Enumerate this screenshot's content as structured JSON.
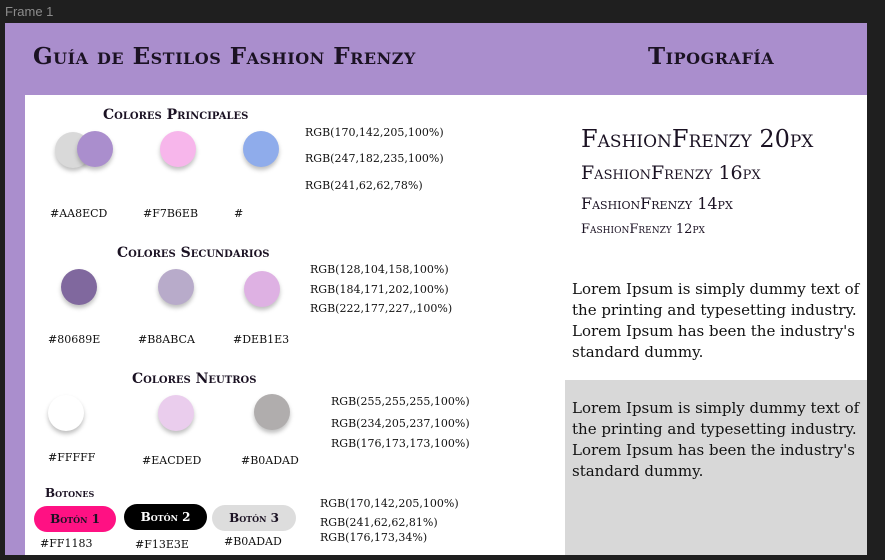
{
  "frame_label": "Frame 1",
  "header": {
    "title": "Guía de Estilos Fashion Frenzy",
    "typography_title": "Tipografía"
  },
  "primary": {
    "title": "Colores Principales",
    "colors": [
      "#AA8ECD",
      "#F7B6EB",
      "#8FACEB"
    ],
    "hex": [
      "#AA8ECD",
      "#F7B6EB",
      "#"
    ],
    "rgb": [
      "RGB(170,142,205,100%)",
      "RGB(247,182,235,100%)",
      "RGB(241,62,62,78%)"
    ]
  },
  "secondary": {
    "title": "Colores Secundarios",
    "colors": [
      "#80689E",
      "#B8ABCA",
      "#DEB1E3"
    ],
    "hex": [
      "#80689E",
      "#B8ABCA",
      "#DEB1E3"
    ],
    "rgb": [
      "RGB(128,104,158,100%)",
      "RGB(184,171,202,100%)",
      "RGB(222,177,227,,100%)"
    ]
  },
  "neutral": {
    "title": "Colores Neutros",
    "colors": [
      "#FFFFFF",
      "#EACDED",
      "#B0ADAD"
    ],
    "hex": [
      "#FFFFF",
      "#EACDED",
      "#B0ADAD"
    ],
    "rgb": [
      "RGB(255,255,255,100%)",
      "RGB(234,205,237,100%)",
      "RGB(176,173,173,100%)"
    ]
  },
  "buttons": {
    "title": "Botones",
    "items": [
      {
        "label": "Botón 1",
        "bg": "#FF1183",
        "fg": "#1b1223"
      },
      {
        "label": "Botón 2",
        "bg": "#000000",
        "fg": "#FFFFFF"
      },
      {
        "label": "Botón 3",
        "bg": "#DDDDDD",
        "fg": "#1b1223"
      }
    ],
    "hex": [
      "#FF1183",
      "#F13E3E",
      "#B0ADAD"
    ],
    "rgb": [
      "RGB(170,142,205,100%)",
      "RGB(241,62,62,81%)",
      "RGB(176,173,34%)"
    ]
  },
  "typography": {
    "samples": [
      "FashionFrenzy 20px",
      "FashionFrenzy 16px",
      "FashionFrenzy 14px",
      "FashionFrenzy 12px"
    ],
    "lorem_1": "Lorem Ipsum is simply dummy text of the printing and typesetting industry. Lorem Ipsum has been the industry's standard dummy.",
    "lorem_2": "Lorem Ipsum is simply dummy text of the printing and typesetting industry. Lorem Ipsum has been the industry's standard dummy."
  }
}
